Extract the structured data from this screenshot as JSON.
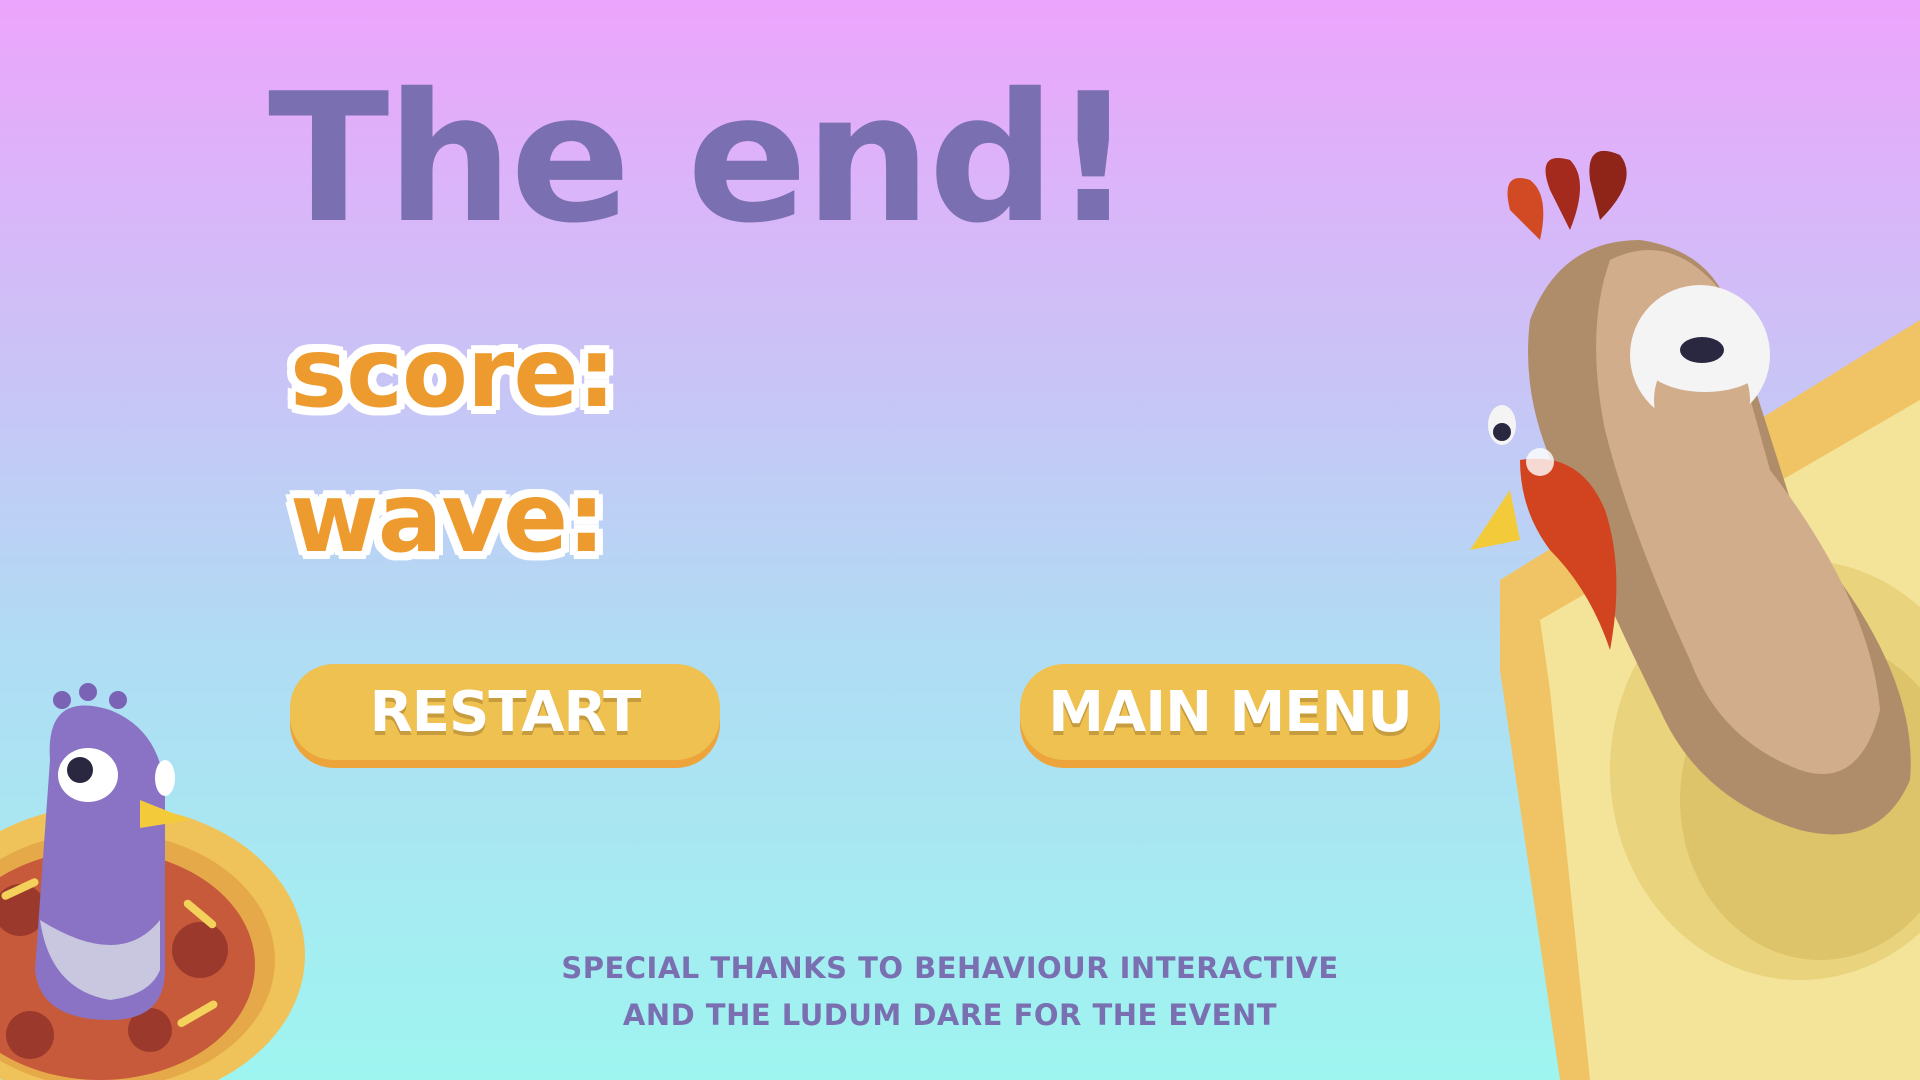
{
  "title": "The end!",
  "stats": {
    "score_label": "score:",
    "wave_label": "wave:"
  },
  "buttons": {
    "restart": "RESTART",
    "main_menu": "MAIN MENU"
  },
  "credits": {
    "line1": "SPECIAL THANKS TO BEHAVIOUR INTERACTIVE",
    "line2": "AND THE LUDUM DARE FOR THE EVENT"
  },
  "colors": {
    "title": "#7a6fb0",
    "stat_text": "#ed9b2e",
    "button": "#eec150",
    "button_shadow": "#eda43a",
    "pigeon_body": "#8a72c4",
    "chicken_body": "#d2ad8b",
    "toast": "#f3e49a"
  },
  "icons": {
    "left_character": "pigeon-on-pizza-icon",
    "right_character": "chicken-on-toast-icon"
  }
}
